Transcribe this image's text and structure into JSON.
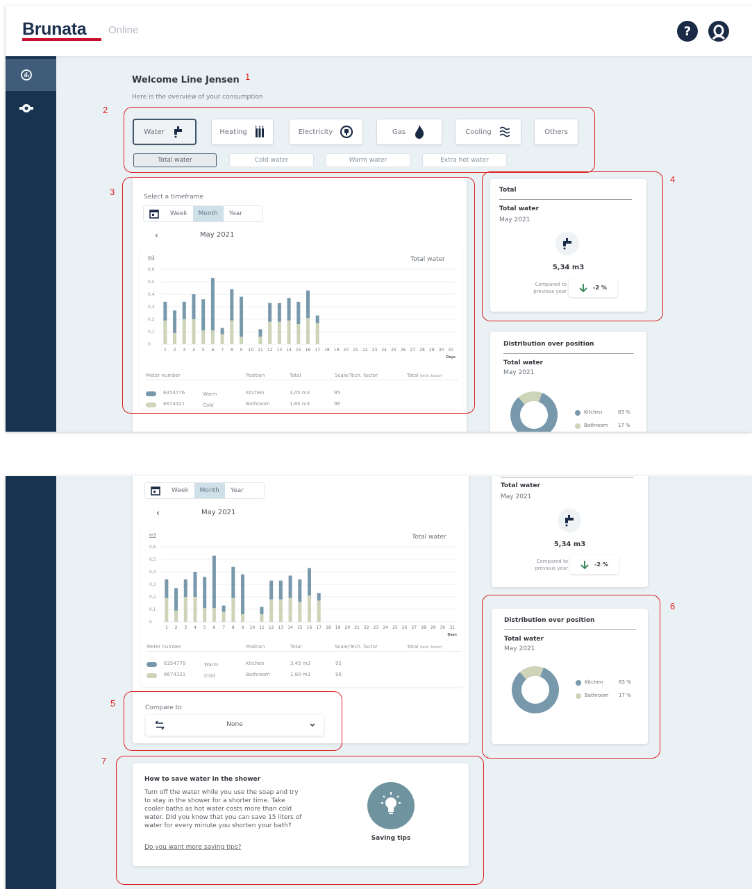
{
  "app": {
    "brand": "Brunata",
    "brand_sub": "Online",
    "help_icon": "question-circle-icon",
    "user_icon": "user-circle-icon"
  },
  "sidebar": {
    "items": [
      {
        "icon": "consumption-chart-icon",
        "active": true
      },
      {
        "icon": "meter-icon",
        "active": false
      }
    ]
  },
  "welcome": {
    "title": "Welcome Line Jensen",
    "subtitle": "Here is the overview of your consumption"
  },
  "utility_types": [
    {
      "label": "Water",
      "icon": "faucet-icon",
      "selected": true
    },
    {
      "label": "Heating",
      "icon": "radiator-icon",
      "selected": false
    },
    {
      "label": "Electricity",
      "icon": "plug-icon",
      "selected": false
    },
    {
      "label": "Gas",
      "icon": "flame-icon",
      "selected": false
    },
    {
      "label": "Cooling",
      "icon": "cooling-icon",
      "selected": false
    },
    {
      "label": "Others",
      "icon": "",
      "selected": false
    }
  ],
  "sub_types": [
    {
      "label": "Total water",
      "selected": true
    },
    {
      "label": "Cold water",
      "selected": false
    },
    {
      "label": "Warm water",
      "selected": false
    },
    {
      "label": "Extra hot water",
      "selected": false
    }
  ],
  "timeframe": {
    "label": "Select a timeframe",
    "options": [
      "Week",
      "Month",
      "Year"
    ],
    "selected": "Month",
    "period": "May 2021",
    "prev_label": "‹"
  },
  "chart_data": {
    "type": "bar",
    "stacked": true,
    "title": "Total water",
    "ylabel": "m3",
    "xlabel": "Days",
    "ylim": [
      0,
      0.6
    ],
    "yticks": [
      "0,6",
      "0,5",
      "0,4",
      "0,3",
      "0,2",
      "0,1",
      "0"
    ],
    "categories": [
      "1",
      "2",
      "3",
      "4",
      "5",
      "6",
      "7",
      "8",
      "9",
      "10",
      "11",
      "12",
      "13",
      "14",
      "15",
      "16",
      "17",
      "18",
      "19",
      "20",
      "21",
      "22",
      "23",
      "24",
      "25",
      "26",
      "27",
      "28",
      "29",
      "30",
      "31"
    ],
    "series": [
      {
        "name": "6354776",
        "color": "#7898ab",
        "values": [
          0.15,
          0.18,
          0.14,
          0.2,
          0.25,
          0.42,
          0.05,
          0.25,
          0.32,
          0,
          0.06,
          0.15,
          0.15,
          0.18,
          0.18,
          0.22,
          0.06,
          0,
          0,
          0,
          0,
          0,
          0,
          0,
          0,
          0,
          0,
          0,
          0,
          0,
          0
        ]
      },
      {
        "name": "6674321",
        "color": "#cdd4b8",
        "values": [
          0.19,
          0.09,
          0.2,
          0.2,
          0.11,
          0.11,
          0.08,
          0.19,
          0.06,
          0,
          0.06,
          0.18,
          0.18,
          0.19,
          0.16,
          0.21,
          0.17,
          0,
          0,
          0,
          0,
          0,
          0,
          0,
          0,
          0,
          0,
          0,
          0,
          0,
          0
        ]
      }
    ]
  },
  "meter_table": {
    "headers": [
      "Meter number",
      "Position",
      "Total",
      "Scale/Tech. factor",
      "Total",
      "(tech. factor)"
    ],
    "rows": [
      {
        "meter": "6354776",
        "type": "Warm",
        "position": "Kitchen",
        "total": "3,45 m3",
        "factor": "95",
        "color": "#7898ab"
      },
      {
        "meter": "6674321",
        "type": "Cold",
        "position": "Bathroom",
        "total": "1,80 m3",
        "factor": "96",
        "color": "#cdd4b8"
      }
    ]
  },
  "total_card": {
    "heading": "Total",
    "name": "Total water",
    "period": "May 2021",
    "value": "5,34 m3",
    "compare_label_1": "Compared to",
    "compare_label_2": "previous year",
    "change": "-2 %",
    "icon": "faucet-icon",
    "arrow_icon": "arrow-down-icon"
  },
  "distribution": {
    "heading": "Distribution over position",
    "name": "Total water",
    "period": "May 2021",
    "items": [
      {
        "label": "Kitchen",
        "percent": "83 %",
        "value": 83,
        "color": "#7898ab"
      },
      {
        "label": "Bathroom",
        "percent": "17 %",
        "value": 17,
        "color": "#cdd4b8"
      }
    ]
  },
  "compare": {
    "label": "Compare to",
    "value": "None",
    "icon": "swap-icon",
    "chevron": "chevron-down-icon"
  },
  "tips": {
    "title": "How to save water in the shower",
    "lines": [
      "Turn off the water while you use the soap and try",
      "to stay in the shower for a shorter time. Take",
      "cooler baths as hot water costs more than cold",
      "water. Did you know that you can save 15 liters of",
      "water for every minute you shorten your bath?"
    ],
    "link": "Do you want more saving tips?",
    "badge_label": "Saving tips",
    "badge_icon": "lightbulb-icon"
  },
  "annotations": [
    "1",
    "2",
    "3",
    "4",
    "5",
    "6",
    "7"
  ]
}
